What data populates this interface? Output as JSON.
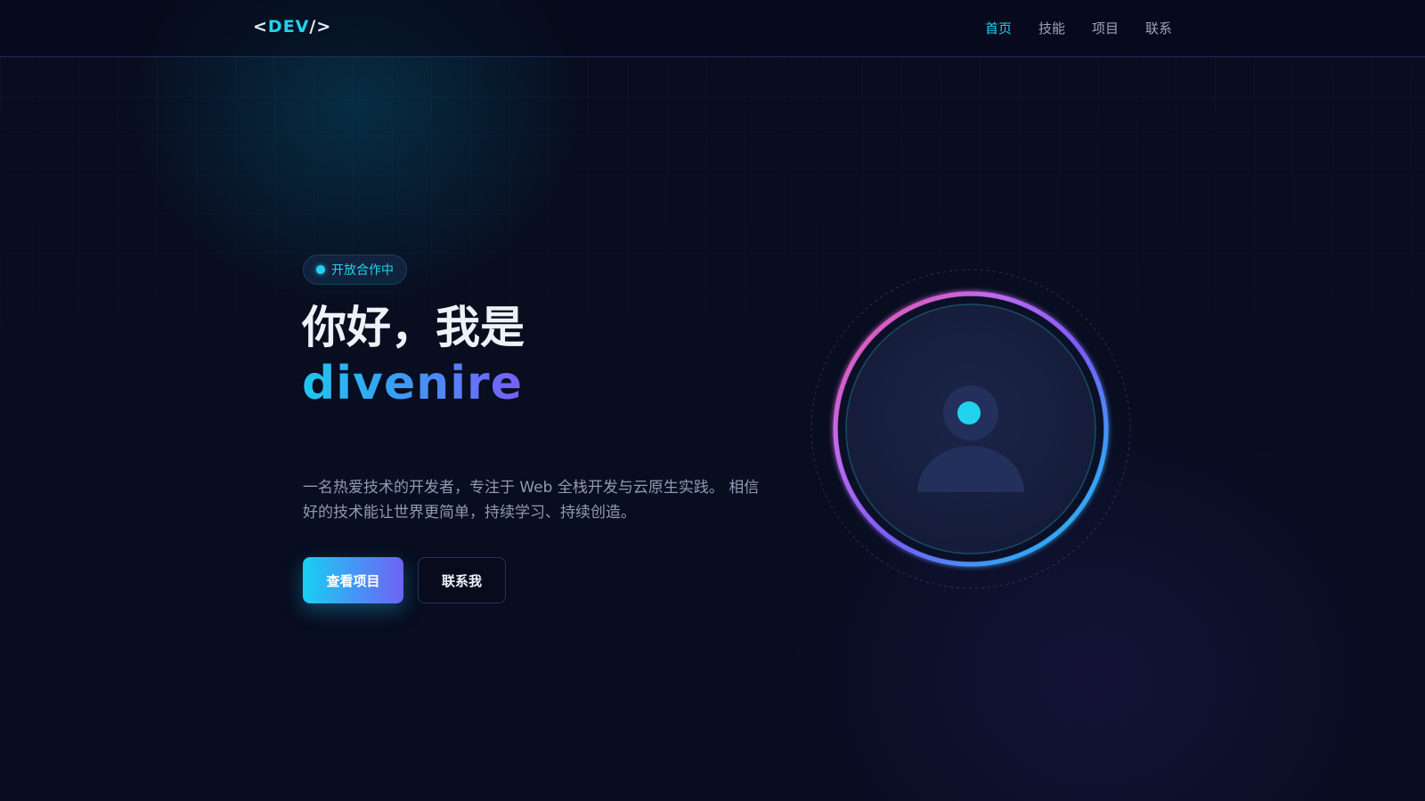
{
  "nav": {
    "logo": {
      "open": "<",
      "name": "DEV",
      "close": "/>"
    },
    "links": [
      {
        "label": "首页",
        "active": true
      },
      {
        "label": "技能",
        "active": false
      },
      {
        "label": "项目",
        "active": false
      },
      {
        "label": "联系",
        "active": false
      }
    ]
  },
  "hero": {
    "badge": "开放合作中",
    "title": "你好，我是",
    "name": "divenire",
    "description": "一名热爱技术的开发者，专注于 Web 全栈开发与云原生实践。 相信好的技术能让世界更简单，持续学习、持续创造。",
    "primary_button": "查看项目",
    "secondary_button": "联系我"
  },
  "avatar": {
    "icon": "user-icon"
  },
  "colors": {
    "accent": "#22d3ee",
    "violet": "#7a5cf5",
    "pink": "#f0509a",
    "background": "#080d1f"
  }
}
